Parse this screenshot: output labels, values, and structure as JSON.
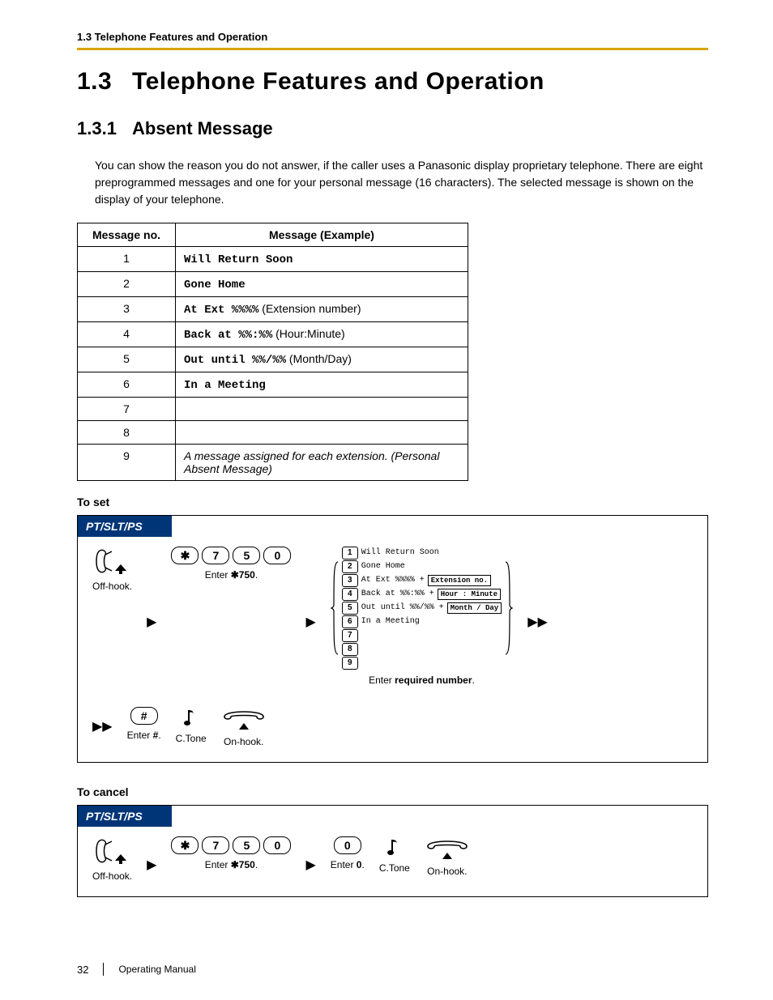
{
  "header": {
    "running": "1.3 Telephone Features and Operation"
  },
  "section": {
    "number": "1.3",
    "title": "Telephone Features and Operation"
  },
  "subsection": {
    "number": "1.3.1",
    "title": "Absent Message"
  },
  "paragraph": "You can show the reason you do not answer, if the caller uses a Panasonic display proprietary telephone. There are eight preprogrammed messages and one for your personal message (16 characters). The selected message is shown on the display of your telephone.",
  "table": {
    "col1": "Message no.",
    "col2": "Message (Example)",
    "rows": {
      "r1": {
        "no": "1",
        "msg": "Will Return Soon"
      },
      "r2": {
        "no": "2",
        "msg": "Gone Home"
      },
      "r3": {
        "no": "3",
        "msg_pre": "At Ext %%%%",
        "msg_note": " (Extension number)"
      },
      "r4": {
        "no": "4",
        "msg_pre": "Back at %%:%%",
        "msg_note": " (Hour:Minute)"
      },
      "r5": {
        "no": "5",
        "msg_pre": "Out until %%/%%",
        "msg_note": " (Month/Day)"
      },
      "r6": {
        "no": "6",
        "msg": "In a Meeting"
      },
      "r7": {
        "no": "7",
        "msg": ""
      },
      "r8": {
        "no": "8",
        "msg": ""
      },
      "r9": {
        "no": "9",
        "msg": "A message assigned for each extension. (Personal Absent Message)"
      }
    }
  },
  "labels": {
    "to_set": "To set",
    "to_cancel": "To cancel"
  },
  "flow": {
    "tab": "PT/SLT/PS",
    "offhook": "Off-hook.",
    "enter750_pre": "Enter ",
    "enter750_code": "750",
    "enter750_suf": ".",
    "options": {
      "n1": "1",
      "t1": "Will Return Soon",
      "n2": "2",
      "t2": "Gone Home",
      "n3": "3",
      "t3": "At Ext %%%% +",
      "n4": "4",
      "t4": "Back at %%:%% +",
      "n5": "5",
      "t5": "Out until %%/%% +",
      "n6": "6",
      "t6": "In a Meeting",
      "n7": "7",
      "n8": "8",
      "n9": "9",
      "p3": "Extension no.",
      "p4": "Hour : Minute",
      "p5": "Month / Day"
    },
    "enter_required_pre": "Enter ",
    "enter_required_bold": "required number",
    "enter_required_suf": ".",
    "enter_hash_pre": "Enter ",
    "enter_hash_bold": "#",
    "enter_hash_suf": ".",
    "ctone": "C.Tone",
    "onhook": "On-hook.",
    "enter0_pre": "Enter ",
    "enter0_bold": "0",
    "enter0_suf": "."
  },
  "keys": {
    "star": "✱",
    "k7": "7",
    "k5": "5",
    "k0": "0",
    "hash": "#"
  },
  "footer": {
    "page": "32",
    "doc": "Operating Manual"
  }
}
